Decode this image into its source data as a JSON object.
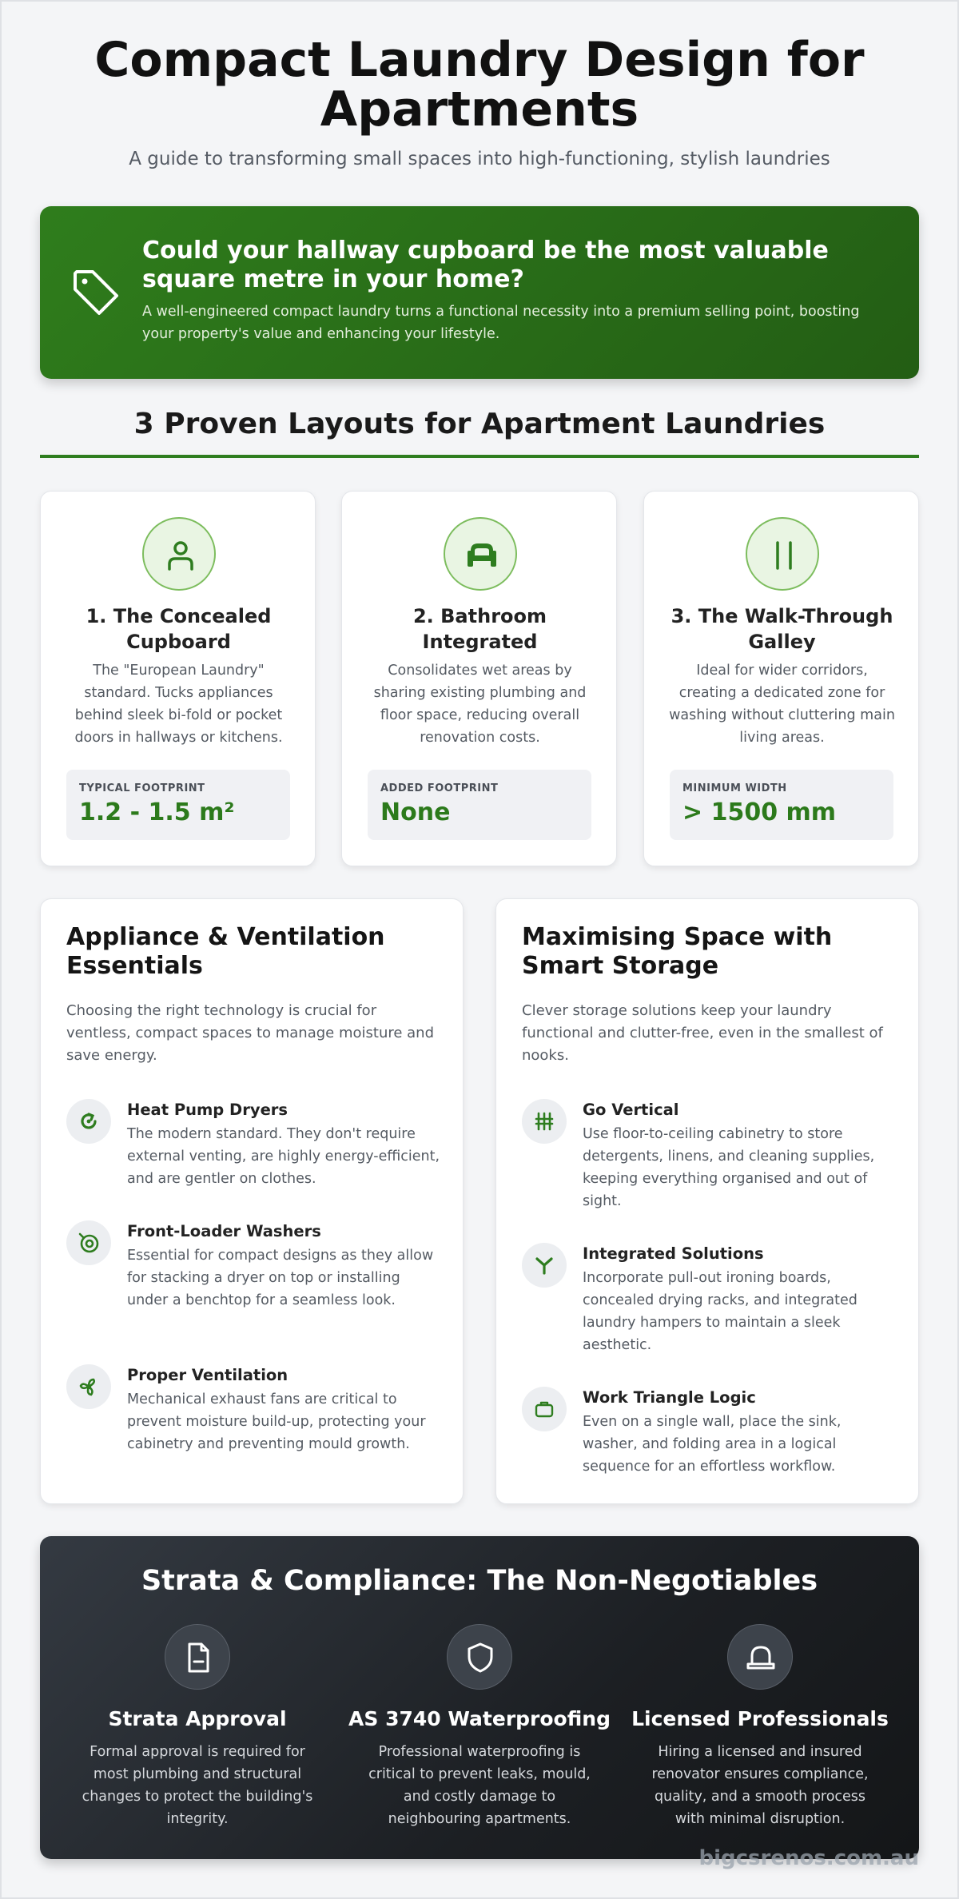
{
  "header": {
    "title": "Compact Laundry Design for Apartments",
    "subtitle": "A guide to transforming small spaces into high-functioning, stylish laundries"
  },
  "hero": {
    "icon": "tag-icon",
    "heading": "Could your hallway cupboard be the most valuable square metre in your home?",
    "text": "A well-engineered compact laundry turns a functional necessity into a premium selling point, boosting your property's value and enhancing your lifestyle."
  },
  "layouts": {
    "section_title": "3 Proven Layouts for Apartment Laundries",
    "items": [
      {
        "icon": "person-icon",
        "title": "1. The Concealed Cupboard",
        "description": "The \"European Laundry\" standard. Tucks appliances behind sleek bi-fold or pocket doors in hallways or kitchens.",
        "stat_label": "TYPICAL FOOTPRINT",
        "stat_value": "1.2 - 1.5 m²"
      },
      {
        "icon": "sink-icon",
        "title": "2. Bathroom Integrated",
        "description": "Consolidates wet areas by sharing existing plumbing and floor space, reducing overall renovation costs.",
        "stat_label": "ADDED FOOTPRINT",
        "stat_value": "None"
      },
      {
        "icon": "parallel-lines-icon",
        "title": "3. The Walk-Through Galley",
        "description": "Ideal for wider corridors, creating a dedicated zone for washing without cluttering main living areas.",
        "stat_label": "MINIMUM WIDTH",
        "stat_value": "> 1500 mm"
      }
    ]
  },
  "appliances": {
    "title": "Appliance & Ventilation Essentials",
    "intro": "Choosing the right technology is crucial for ventless, compact spaces to manage moisture and save energy.",
    "features": [
      {
        "icon": "recycle-icon",
        "title": "Heat Pump Dryers",
        "text": "The modern standard. They don't require external venting, are highly energy-efficient, and are gentler on clothes."
      },
      {
        "icon": "washer-icon",
        "title": "Front-Loader Washers",
        "text": "Essential for compact designs as they allow for stacking a dryer on top or installing under a benchtop for a seamless look."
      },
      {
        "icon": "fan-icon",
        "title": "Proper Ventilation",
        "text": "Mechanical exhaust fans are critical to prevent moisture build-up, protecting your cabinetry and preventing mould growth."
      }
    ]
  },
  "storage": {
    "title": "Maximising Space with Smart Storage",
    "intro": "Clever storage solutions keep your laundry functional and clutter-free, even in the smallest of nooks.",
    "features": [
      {
        "icon": "shelves-icon",
        "title": "Go Vertical",
        "text": "Use floor-to-ceiling cabinetry to store detergents, linens, and cleaning supplies, keeping everything organised and out of sight."
      },
      {
        "icon": "merge-icon",
        "title": "Integrated Solutions",
        "text": "Incorporate pull-out ironing boards, concealed drying racks, and integrated laundry hampers to maintain a sleek aesthetic."
      },
      {
        "icon": "briefcase-icon",
        "title": "Work Triangle Logic",
        "text": "Even on a single wall, place the sink, washer, and folding area in a logical sequence for an effortless workflow."
      }
    ]
  },
  "strata": {
    "title": "Strata & Compliance: The Non-Negotiables",
    "items": [
      {
        "icon": "document-icon",
        "title": "Strata Approval",
        "text": "Formal approval is required for most plumbing and structural changes to protect the building's integrity."
      },
      {
        "icon": "shield-icon",
        "title": "AS 3740 Waterproofing",
        "text": "Professional waterproofing is critical to prevent leaks, mould, and costly damage to neighbouring apartments."
      },
      {
        "icon": "hard-hat-icon",
        "title": "Licensed Professionals",
        "text": "Hiring a licensed and insured renovator ensures compliance, quality, and a smooth process with minimal disruption."
      }
    ]
  },
  "watermark": "bigcsrenos.com.au",
  "colors": {
    "accent_green": "#2e7d1f",
    "dark_banner": "#1c1f23",
    "page_bg": "#f4f5f7"
  }
}
